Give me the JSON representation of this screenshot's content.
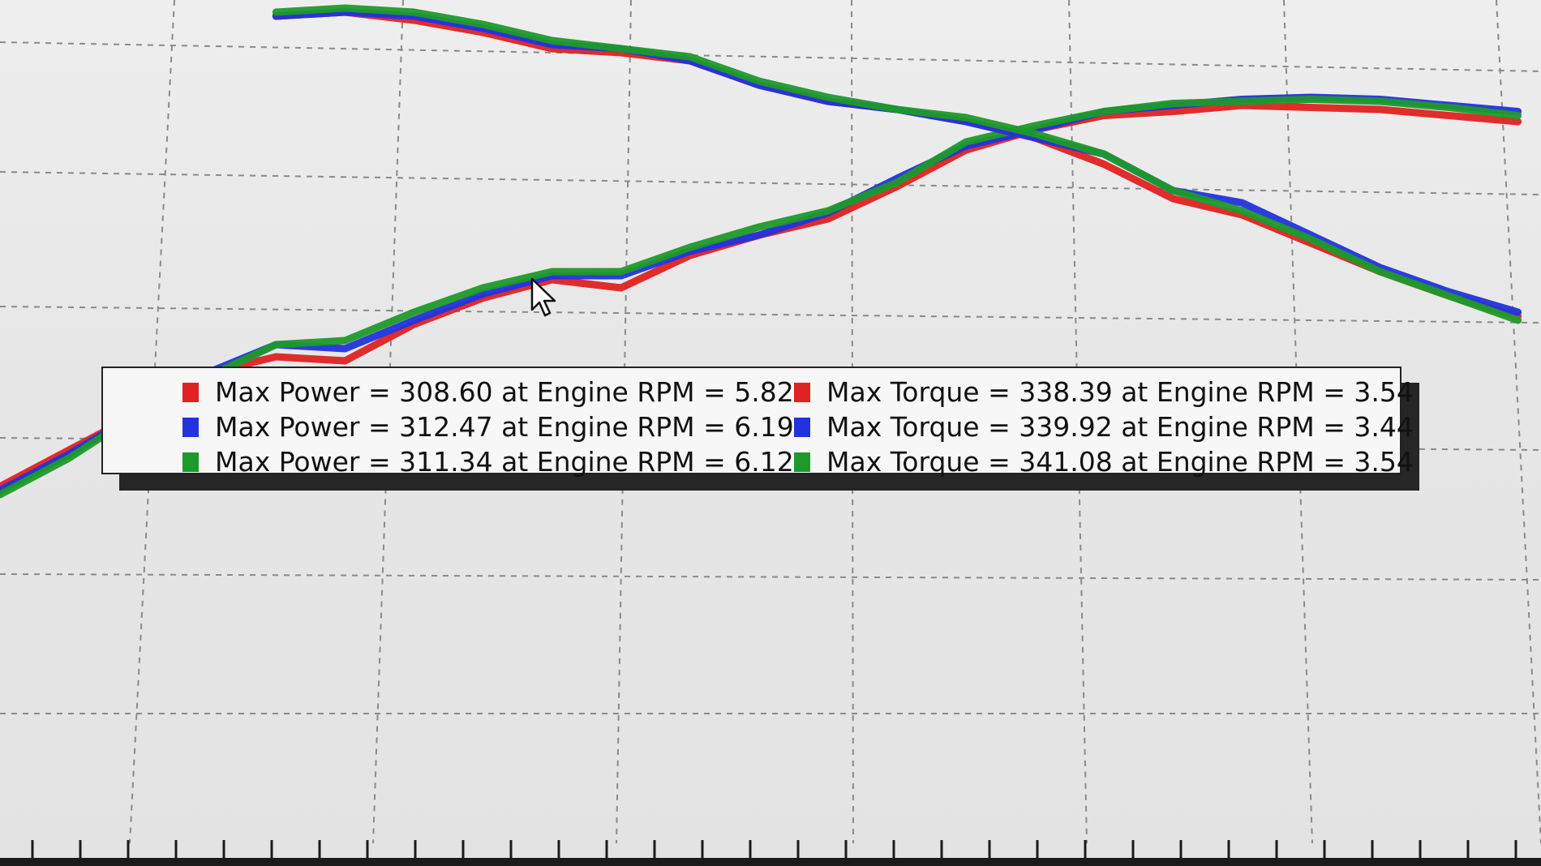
{
  "colors": {
    "red": "#e02222",
    "blue": "#2233dd",
    "green": "#1e9a2a",
    "grid": "#8a8a8a"
  },
  "legend": {
    "power": [
      {
        "color": "#e02222",
        "text": "Max Power = 308.60 at Engine RPM = 5.82"
      },
      {
        "color": "#2233dd",
        "text": "Max Power = 312.47 at Engine RPM = 6.19"
      },
      {
        "color": "#1e9a2a",
        "text": "Max Power = 311.34 at Engine RPM = 6.12"
      }
    ],
    "torque": [
      {
        "color": "#e02222",
        "text": "Max Torque = 338.39 at Engine RPM = 3.54"
      },
      {
        "color": "#2233dd",
        "text": "Max Torque = 339.92 at Engine RPM = 3.44"
      },
      {
        "color": "#1e9a2a",
        "text": "Max Torque = 341.08 at Engine RPM = 3.54"
      }
    ]
  },
  "chart_data": {
    "type": "line",
    "title": "",
    "xlabel": "",
    "ylabel": "",
    "grid": true,
    "legend_position": "center",
    "xlim": [
      1.2,
      7.9
    ],
    "ylim": [
      0,
      360
    ],
    "x": [
      1.2,
      1.5,
      1.8,
      2.1,
      2.4,
      2.7,
      3.0,
      3.3,
      3.6,
      3.9,
      4.2,
      4.5,
      4.8,
      5.1,
      5.4,
      5.7,
      6.0,
      6.3,
      6.6,
      6.9,
      7.2,
      7.5,
      7.8
    ],
    "series": [
      {
        "color": "#e02222",
        "values": [
          120,
          138,
          156,
          176,
          184,
          182,
          200,
          213,
          222,
          218,
          234,
          244,
          252,
          268,
          286,
          296,
          303,
          305,
          308,
          307,
          306,
          303,
          300
        ]
      },
      {
        "color": "#2233dd",
        "values": [
          118,
          136,
          156,
          176,
          190,
          188,
          202,
          215,
          224,
          224,
          236,
          244,
          255,
          272,
          288,
          296,
          305,
          308,
          311,
          312,
          311,
          308,
          305
        ]
      },
      {
        "color": "#1e9a2a",
        "values": [
          116,
          134,
          156,
          174,
          190,
          192,
          206,
          218,
          226,
          226,
          238,
          248,
          256,
          270,
          290,
          298,
          305,
          309,
          310,
          311,
          310,
          307,
          303
        ]
      },
      {
        "color": "#e02222",
        "values": [
          null,
          null,
          null,
          null,
          352,
          354,
          350,
          344,
          336,
          334,
          330,
          318,
          310,
          306,
          300,
          292,
          279,
          262,
          254,
          240,
          226,
          214,
          204
        ]
      },
      {
        "color": "#2233dd",
        "values": [
          null,
          null,
          null,
          null,
          352,
          354,
          352,
          346,
          338,
          336,
          330,
          318,
          310,
          306,
          300,
          292,
          284,
          266,
          260,
          244,
          228,
          216,
          206
        ]
      },
      {
        "color": "#1e9a2a",
        "values": [
          null,
          null,
          null,
          null,
          354,
          356,
          354,
          348,
          340,
          336,
          332,
          320,
          312,
          306,
          302,
          294,
          284,
          266,
          256,
          242,
          226,
          214,
          202
        ]
      }
    ]
  }
}
